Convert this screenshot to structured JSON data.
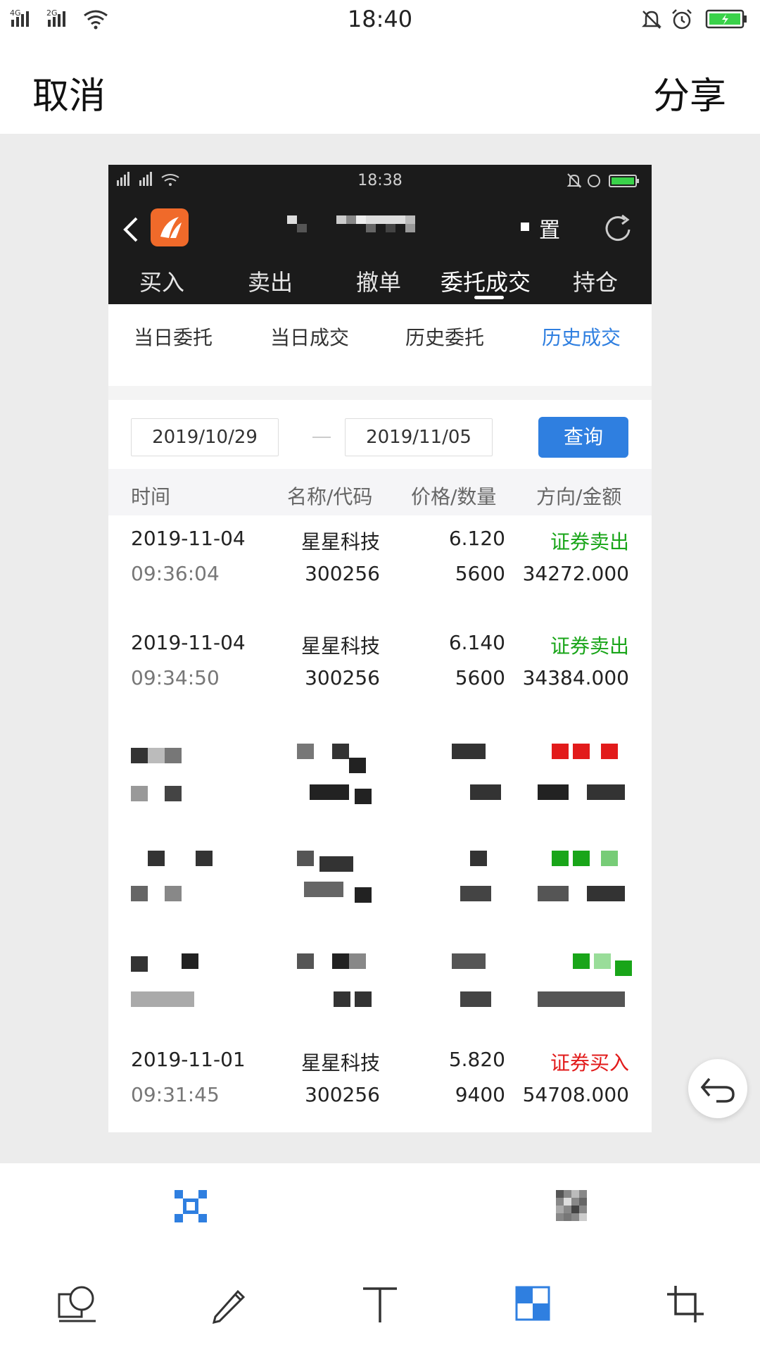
{
  "status_bar": {
    "time": "18:40",
    "network_1": "4G",
    "network_2": "2G"
  },
  "top_bar": {
    "cancel": "取消",
    "share": "分享"
  },
  "screenshot": {
    "status_time": "18:38",
    "header_setting": "置",
    "tabs": [
      "买入",
      "卖出",
      "撤单",
      "委托成交",
      "持仓"
    ],
    "active_tab": "委托成交",
    "sub_tabs": [
      "当日委托",
      "当日成交",
      "历史委托",
      "历史成交"
    ],
    "active_sub_tab": "历史成交",
    "start_date": "2019/10/29",
    "end_date": "2019/11/05",
    "query_button": "查询",
    "columns": [
      "时间",
      "名称/代码",
      "价格/数量",
      "方向/金额"
    ],
    "rows": [
      {
        "date": "2019-11-04",
        "time": "09:36:04",
        "name": "星星科技",
        "code": "300256",
        "price": "6.120",
        "qty": "5600",
        "direction": "证券卖出",
        "amount": "34272.000",
        "type": "sell"
      },
      {
        "date": "2019-11-04",
        "time": "09:34:50",
        "name": "星星科技",
        "code": "300256",
        "price": "6.140",
        "qty": "5600",
        "direction": "证券卖出",
        "amount": "34384.000",
        "type": "sell"
      },
      {
        "date": "2019-11-01",
        "time": "09:31:45",
        "name": "星星科技",
        "code": "300256",
        "price": "5.820",
        "qty": "9400",
        "direction": "证券买入",
        "amount": "54708.000",
        "type": "buy"
      }
    ]
  },
  "colors": {
    "accent": "#2f7fe0",
    "sell": "#19a519",
    "buy": "#e21b1b",
    "dark_header": "#1b1b1b"
  },
  "tools": [
    "shape-tool-icon",
    "pen-tool-icon",
    "text-tool-icon",
    "mosaic-tool-icon",
    "crop-tool-icon"
  ]
}
